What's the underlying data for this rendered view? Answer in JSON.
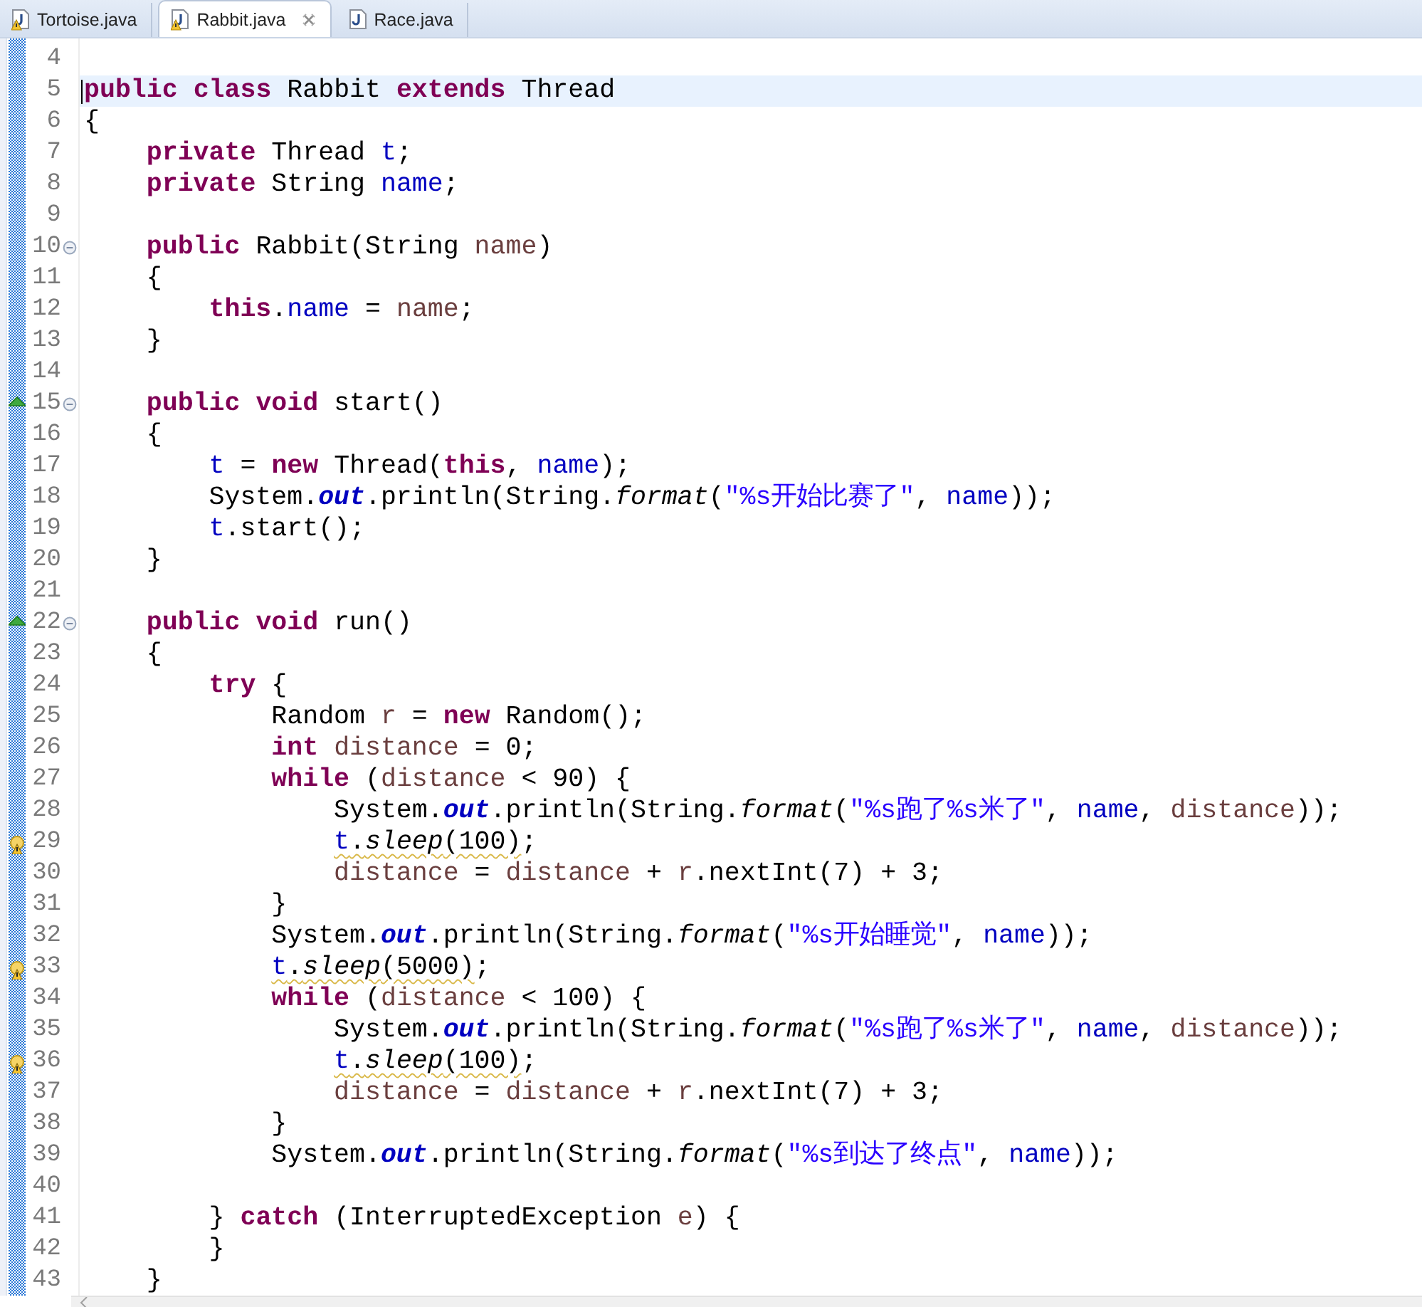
{
  "tabs": [
    {
      "label": "Tortoise.java",
      "selected": false,
      "warning": true,
      "closable": false
    },
    {
      "label": "Rabbit.java",
      "selected": true,
      "warning": true,
      "closable": true
    },
    {
      "label": "Race.java",
      "selected": false,
      "warning": false,
      "closable": false
    }
  ],
  "editor": {
    "lines": [
      {
        "number": "4"
      },
      {
        "number": "5",
        "current": true,
        "tokens": [
          {
            "text": "public",
            "kind": "kw"
          },
          {
            "text": " class",
            "kind": "kw"
          },
          {
            "text": " Rabbit ",
            "kind": "plain"
          },
          {
            "text": "extends",
            "kind": "kw"
          },
          {
            "text": " Thread",
            "kind": "plain"
          }
        ]
      },
      {
        "number": "6",
        "tokens": [
          {
            "text": "{",
            "kind": "plain"
          }
        ]
      },
      {
        "number": "7",
        "tokens": [
          {
            "text": "    private",
            "kind": "kw"
          },
          {
            "text": " Thread ",
            "kind": "plain"
          },
          {
            "text": "t",
            "kind": "field"
          },
          {
            "text": ";",
            "kind": "plain"
          }
        ]
      },
      {
        "number": "8",
        "tokens": [
          {
            "text": "    private",
            "kind": "kw"
          },
          {
            "text": " String ",
            "kind": "plain"
          },
          {
            "text": "name",
            "kind": "field"
          },
          {
            "text": ";",
            "kind": "plain"
          }
        ]
      },
      {
        "number": "9"
      },
      {
        "number": "10",
        "fold": true,
        "tokens": [
          {
            "text": "    public",
            "kind": "kw"
          },
          {
            "text": " Rabbit(String ",
            "kind": "plain"
          },
          {
            "text": "name",
            "kind": "local"
          },
          {
            "text": ")",
            "kind": "plain"
          }
        ]
      },
      {
        "number": "11",
        "tokens": [
          {
            "text": "    {",
            "kind": "plain"
          }
        ]
      },
      {
        "number": "12",
        "tokens": [
          {
            "text": "        this",
            "kind": "kw"
          },
          {
            "text": ".",
            "kind": "plain"
          },
          {
            "text": "name",
            "kind": "field"
          },
          {
            "text": " = ",
            "kind": "plain"
          },
          {
            "text": "name",
            "kind": "local"
          },
          {
            "text": ";",
            "kind": "plain"
          }
        ]
      },
      {
        "number": "13",
        "tokens": [
          {
            "text": "    }",
            "kind": "plain"
          }
        ]
      },
      {
        "number": "14"
      },
      {
        "number": "15",
        "fold": true,
        "override": true,
        "tokens": [
          {
            "text": "    public",
            "kind": "kw"
          },
          {
            "text": " void",
            "kind": "kw"
          },
          {
            "text": " start()",
            "kind": "plain"
          }
        ]
      },
      {
        "number": "16",
        "tokens": [
          {
            "text": "    {",
            "kind": "plain"
          }
        ]
      },
      {
        "number": "17",
        "tokens": [
          {
            "text": "        t",
            "kind": "field"
          },
          {
            "text": " = ",
            "kind": "plain"
          },
          {
            "text": "new",
            "kind": "kw"
          },
          {
            "text": " Thread(",
            "kind": "plain"
          },
          {
            "text": "this",
            "kind": "kw"
          },
          {
            "text": ", ",
            "kind": "plain"
          },
          {
            "text": "name",
            "kind": "field"
          },
          {
            "text": ");",
            "kind": "plain"
          }
        ]
      },
      {
        "number": "18",
        "tokens": [
          {
            "text": "        System.",
            "kind": "plain"
          },
          {
            "text": "out",
            "kind": "sfield"
          },
          {
            "text": ".println(String.",
            "kind": "plain"
          },
          {
            "text": "format",
            "kind": "smethod"
          },
          {
            "text": "(",
            "kind": "plain"
          },
          {
            "text": "\"%s开始比赛了\"",
            "kind": "string"
          },
          {
            "text": ", ",
            "kind": "plain"
          },
          {
            "text": "name",
            "kind": "field"
          },
          {
            "text": "));",
            "kind": "plain"
          }
        ]
      },
      {
        "number": "19",
        "tokens": [
          {
            "text": "        t",
            "kind": "field"
          },
          {
            "text": ".start();",
            "kind": "plain"
          }
        ]
      },
      {
        "number": "20",
        "tokens": [
          {
            "text": "    }",
            "kind": "plain"
          }
        ]
      },
      {
        "number": "21"
      },
      {
        "number": "22",
        "fold": true,
        "override": true,
        "tokens": [
          {
            "text": "    public",
            "kind": "kw"
          },
          {
            "text": " void",
            "kind": "kw"
          },
          {
            "text": " run()",
            "kind": "plain"
          }
        ]
      },
      {
        "number": "23",
        "tokens": [
          {
            "text": "    {",
            "kind": "plain"
          }
        ]
      },
      {
        "number": "24",
        "tokens": [
          {
            "text": "        try",
            "kind": "kw"
          },
          {
            "text": " {",
            "kind": "plain"
          }
        ]
      },
      {
        "number": "25",
        "tokens": [
          {
            "text": "            Random ",
            "kind": "plain"
          },
          {
            "text": "r",
            "kind": "local"
          },
          {
            "text": " = ",
            "kind": "plain"
          },
          {
            "text": "new",
            "kind": "kw"
          },
          {
            "text": " Random();",
            "kind": "plain"
          }
        ]
      },
      {
        "number": "26",
        "tokens": [
          {
            "text": "            int",
            "kind": "kw"
          },
          {
            "text": " distance",
            "kind": "local"
          },
          {
            "text": " = 0;",
            "kind": "plain"
          }
        ]
      },
      {
        "number": "27",
        "tokens": [
          {
            "text": "            while",
            "kind": "kw"
          },
          {
            "text": " (",
            "kind": "plain"
          },
          {
            "text": "distance",
            "kind": "local"
          },
          {
            "text": " < 90) {",
            "kind": "plain"
          }
        ]
      },
      {
        "number": "28",
        "tokens": [
          {
            "text": "                System.",
            "kind": "plain"
          },
          {
            "text": "out",
            "kind": "sfield"
          },
          {
            "text": ".println(String.",
            "kind": "plain"
          },
          {
            "text": "format",
            "kind": "smethod"
          },
          {
            "text": "(",
            "kind": "plain"
          },
          {
            "text": "\"%s跑了%s米了\"",
            "kind": "string"
          },
          {
            "text": ", ",
            "kind": "plain"
          },
          {
            "text": "name",
            "kind": "field"
          },
          {
            "text": ", ",
            "kind": "plain"
          },
          {
            "text": "distance",
            "kind": "local"
          },
          {
            "text": "));",
            "kind": "plain"
          }
        ]
      },
      {
        "number": "29",
        "warning": true,
        "tokens": [
          {
            "text": "                t",
            "kind": "field",
            "squiggle": true
          },
          {
            "text": ".",
            "kind": "plain",
            "squiggle": true
          },
          {
            "text": "sleep",
            "kind": "smethod",
            "squiggle": true
          },
          {
            "text": "(100)",
            "kind": "plain",
            "squiggle": true
          },
          {
            "text": ";",
            "kind": "plain"
          }
        ]
      },
      {
        "number": "30",
        "tokens": [
          {
            "text": "                distance",
            "kind": "local"
          },
          {
            "text": " = ",
            "kind": "plain"
          },
          {
            "text": "distance",
            "kind": "local"
          },
          {
            "text": " + ",
            "kind": "plain"
          },
          {
            "text": "r",
            "kind": "local"
          },
          {
            "text": ".nextInt(7) + 3;",
            "kind": "plain"
          }
        ]
      },
      {
        "number": "31",
        "tokens": [
          {
            "text": "            }",
            "kind": "plain"
          }
        ]
      },
      {
        "number": "32",
        "tokens": [
          {
            "text": "            System.",
            "kind": "plain"
          },
          {
            "text": "out",
            "kind": "sfield"
          },
          {
            "text": ".println(String.",
            "kind": "plain"
          },
          {
            "text": "format",
            "kind": "smethod"
          },
          {
            "text": "(",
            "kind": "plain"
          },
          {
            "text": "\"%s开始睡觉\"",
            "kind": "string"
          },
          {
            "text": ", ",
            "kind": "plain"
          },
          {
            "text": "name",
            "kind": "field"
          },
          {
            "text": "));",
            "kind": "plain"
          }
        ]
      },
      {
        "number": "33",
        "warning": true,
        "tokens": [
          {
            "text": "            t",
            "kind": "field",
            "squiggle": true
          },
          {
            "text": ".",
            "kind": "plain",
            "squiggle": true
          },
          {
            "text": "sleep",
            "kind": "smethod",
            "squiggle": true
          },
          {
            "text": "(5000)",
            "kind": "plain",
            "squiggle": true
          },
          {
            "text": ";",
            "kind": "plain"
          }
        ]
      },
      {
        "number": "34",
        "tokens": [
          {
            "text": "            while",
            "kind": "kw"
          },
          {
            "text": " (",
            "kind": "plain"
          },
          {
            "text": "distance",
            "kind": "local"
          },
          {
            "text": " < 100) {",
            "kind": "plain"
          }
        ]
      },
      {
        "number": "35",
        "tokens": [
          {
            "text": "                System.",
            "kind": "plain"
          },
          {
            "text": "out",
            "kind": "sfield"
          },
          {
            "text": ".println(String.",
            "kind": "plain"
          },
          {
            "text": "format",
            "kind": "smethod"
          },
          {
            "text": "(",
            "kind": "plain"
          },
          {
            "text": "\"%s跑了%s米了\"",
            "kind": "string"
          },
          {
            "text": ", ",
            "kind": "plain"
          },
          {
            "text": "name",
            "kind": "field"
          },
          {
            "text": ", ",
            "kind": "plain"
          },
          {
            "text": "distance",
            "kind": "local"
          },
          {
            "text": "));",
            "kind": "plain"
          }
        ]
      },
      {
        "number": "36",
        "warning": true,
        "tokens": [
          {
            "text": "                t",
            "kind": "field",
            "squiggle": true
          },
          {
            "text": ".",
            "kind": "plain",
            "squiggle": true
          },
          {
            "text": "sleep",
            "kind": "smethod",
            "squiggle": true
          },
          {
            "text": "(100)",
            "kind": "plain",
            "squiggle": true
          },
          {
            "text": ";",
            "kind": "plain"
          }
        ]
      },
      {
        "number": "37",
        "tokens": [
          {
            "text": "                distance",
            "kind": "local"
          },
          {
            "text": " = ",
            "kind": "plain"
          },
          {
            "text": "distance",
            "kind": "local"
          },
          {
            "text": " + ",
            "kind": "plain"
          },
          {
            "text": "r",
            "kind": "local"
          },
          {
            "text": ".nextInt(7) + 3;",
            "kind": "plain"
          }
        ]
      },
      {
        "number": "38",
        "tokens": [
          {
            "text": "            }",
            "kind": "plain"
          }
        ]
      },
      {
        "number": "39",
        "tokens": [
          {
            "text": "            System.",
            "kind": "plain"
          },
          {
            "text": "out",
            "kind": "sfield"
          },
          {
            "text": ".println(String.",
            "kind": "plain"
          },
          {
            "text": "format",
            "kind": "smethod"
          },
          {
            "text": "(",
            "kind": "plain"
          },
          {
            "text": "\"%s到达了终点\"",
            "kind": "string"
          },
          {
            "text": ", ",
            "kind": "plain"
          },
          {
            "text": "name",
            "kind": "field"
          },
          {
            "text": "));",
            "kind": "plain"
          }
        ]
      },
      {
        "number": "40"
      },
      {
        "number": "41",
        "tokens": [
          {
            "text": "        } ",
            "kind": "plain"
          },
          {
            "text": "catch",
            "kind": "kw"
          },
          {
            "text": " (InterruptedException ",
            "kind": "plain"
          },
          {
            "text": "e",
            "kind": "local"
          },
          {
            "text": ") {",
            "kind": "plain"
          }
        ]
      },
      {
        "number": "42",
        "tokens": [
          {
            "text": "        }",
            "kind": "plain"
          }
        ]
      },
      {
        "number": "43",
        "tokens": [
          {
            "text": "    }",
            "kind": "plain"
          }
        ]
      }
    ]
  }
}
